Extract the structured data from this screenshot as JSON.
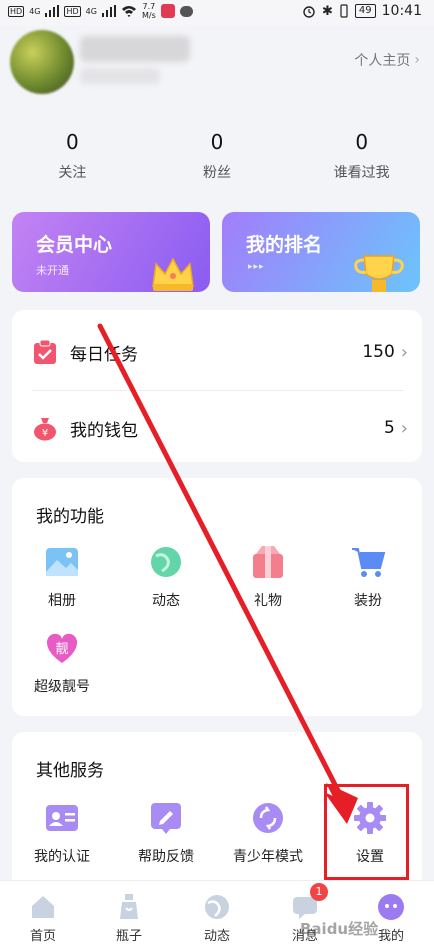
{
  "status_bar": {
    "network_badges": [
      "HD",
      "HD"
    ],
    "net_types": [
      "4G",
      "4G"
    ],
    "speed_value": "7.7",
    "speed_unit": "M/s",
    "battery": "49",
    "time": "10:41"
  },
  "profile": {
    "homepage_label": "个人主页"
  },
  "stats": [
    {
      "value": "0",
      "label": "关注"
    },
    {
      "value": "0",
      "label": "粉丝"
    },
    {
      "value": "0",
      "label": "谁看过我"
    }
  ],
  "vip_card": {
    "title": "会员中心",
    "subtitle": "未开通"
  },
  "rank_card": {
    "title": "我的排名",
    "arrows": "▸▸▸"
  },
  "tasks": [
    {
      "label": "每日任务",
      "value": "150"
    },
    {
      "label": "我的钱包",
      "value": "5"
    }
  ],
  "functions": {
    "title": "我的功能",
    "items": [
      {
        "label": "相册",
        "icon": "album-icon"
      },
      {
        "label": "动态",
        "icon": "moments-icon"
      },
      {
        "label": "礼物",
        "icon": "gift-icon"
      },
      {
        "label": "装扮",
        "icon": "cart-icon"
      },
      {
        "label": "超级靓号",
        "icon": "pretty-number-icon",
        "glyph": "靓"
      }
    ]
  },
  "services": {
    "title": "其他服务",
    "items": [
      {
        "label": "我的认证",
        "icon": "id-card-icon"
      },
      {
        "label": "帮助反馈",
        "icon": "feedback-icon"
      },
      {
        "label": "青少年模式",
        "icon": "youth-mode-icon"
      },
      {
        "label": "设置",
        "icon": "gear-icon"
      }
    ]
  },
  "tabbar": [
    {
      "label": "首页",
      "icon": "home-icon"
    },
    {
      "label": "瓶子",
      "icon": "bottle-icon"
    },
    {
      "label": "动态",
      "icon": "planet-icon"
    },
    {
      "label": "消息",
      "icon": "message-icon",
      "badge": "1"
    },
    {
      "label": "我的",
      "icon": "profile-icon"
    }
  ],
  "watermark": "Baidu经验",
  "colors": {
    "accent_purple": "#8a5cf1",
    "annotation_red": "#e61e25",
    "badge_red": "#f24444"
  }
}
